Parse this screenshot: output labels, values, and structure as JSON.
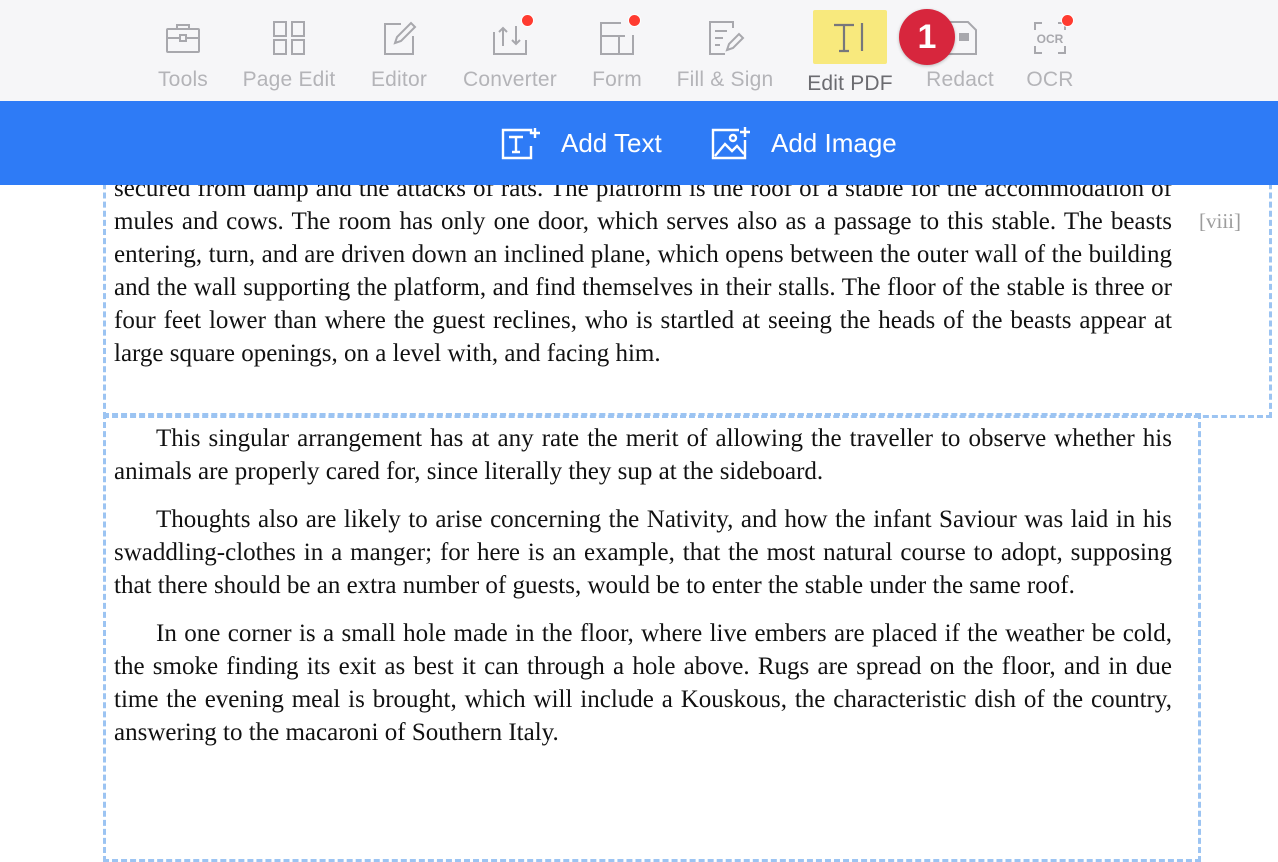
{
  "toolbar": {
    "tools": [
      {
        "label": "Tools",
        "icon": "toolbox-icon"
      },
      {
        "label": "Page Edit",
        "icon": "grid-icon"
      },
      {
        "label": "Editor",
        "icon": "pencil-square-icon"
      },
      {
        "label": "Converter",
        "icon": "convert-icon"
      },
      {
        "label": "Form",
        "icon": "form-icon"
      },
      {
        "label": "Fill & Sign",
        "icon": "sign-icon"
      },
      {
        "label": "Edit PDF",
        "icon": "text-cursor-icon"
      },
      {
        "label": "Redact",
        "icon": "redact-icon"
      },
      {
        "label": "OCR",
        "icon": "ocr-icon",
        "icon_text": "OCR"
      }
    ],
    "active": "Edit PDF"
  },
  "step_badge": "1",
  "subbar": {
    "add_text": "Add Text",
    "add_image": "Add Image"
  },
  "document": {
    "margin_note": "[viii]",
    "block1": "secured from damp and the attacks of rats. The platform is the roof of a stable for the accommodation of mules and cows. The room has only one door, which serves also as a passage to this stable. The beasts entering, turn, and are driven down an inclined plane, which opens between the outer wall of the building and the wall supporting the platform, and find themselves in their stalls. The floor of the stable is three or four feet lower than where the guest reclines, who is startled at seeing the heads of the beasts appear at large square openings, on a level with, and facing him.",
    "paragraphs": [
      "This singular arrangement has at any rate the merit of allowing the traveller to observe whether his animals are properly cared for, since literally they sup at the sideboard.",
      "Thoughts also are likely to arise concerning the Nativity, and how the infant Saviour was laid in his swaddling-clothes in a manger; for here is an example, that the most natural course to adopt, supposing that there should be an extra number of guests, would be to enter the stable under the same roof.",
      "In one corner is a small hole made in the floor, where live embers are placed if the weather be cold, the smoke finding its exit as best it can through a hole above. Rugs are spread on the floor, and in due time the evening meal is brought, which will include a Kouskous, the characteristic dish of the country, answering to the macaroni of Southern Italy."
    ]
  },
  "colors": {
    "accent_blue": "#2e7bf6",
    "highlight_yellow": "#f8e97d",
    "badge_red": "#d7263d",
    "notification_dot": "#ff3b30",
    "dashed_border": "#9cc4f2"
  }
}
